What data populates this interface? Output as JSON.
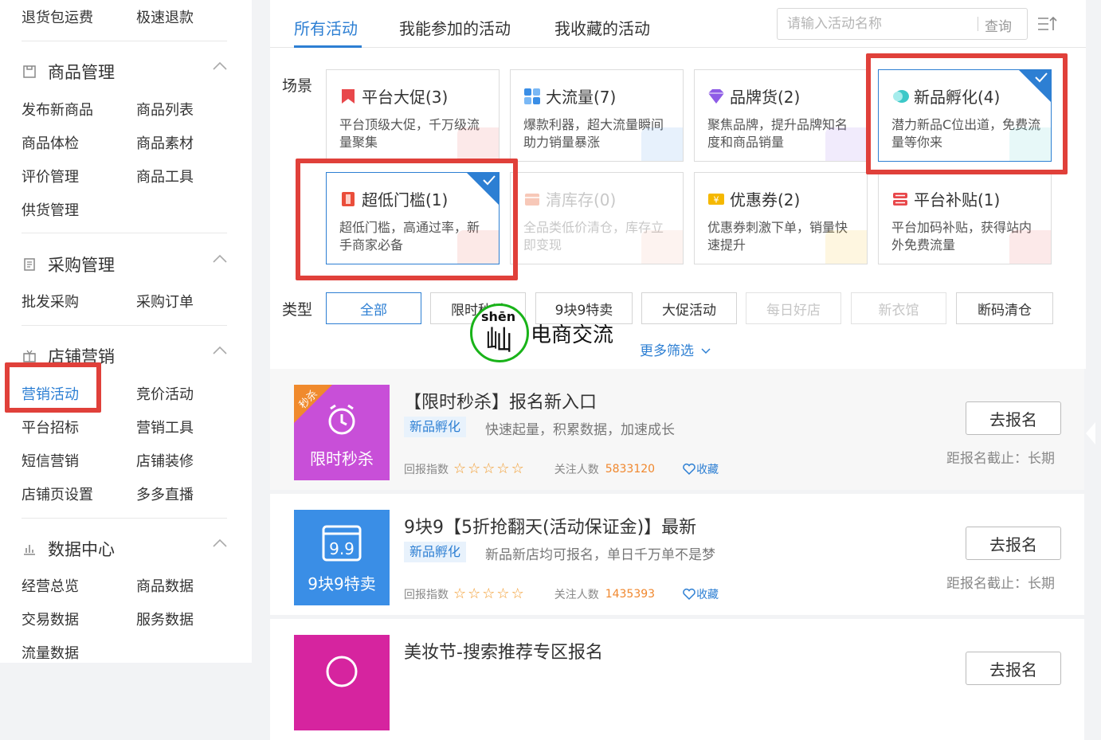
{
  "sidebar": {
    "top_row": [
      "退货包运费",
      "极速退款"
    ],
    "sections": [
      {
        "title": "商品管理",
        "icon": "clipboard-icon",
        "items": [
          "发布新商品",
          "商品列表",
          "商品体检",
          "商品素材",
          "评价管理",
          "商品工具",
          "供货管理"
        ]
      },
      {
        "title": "采购管理",
        "icon": "purchase-list-icon",
        "items": [
          "批发采购",
          "采购订单"
        ]
      },
      {
        "title": "店铺营销",
        "icon": "gift-icon",
        "items": [
          "营销活动",
          "竞价活动",
          "平台招标",
          "营销工具",
          "短信营销",
          "店铺装修",
          "店铺页设置",
          "多多直播"
        ]
      },
      {
        "title": "数据中心",
        "icon": "bar-chart-icon",
        "items": [
          "经营总览",
          "商品数据",
          "交易数据",
          "服务数据",
          "流量数据"
        ]
      }
    ],
    "active_item": "营销活动"
  },
  "header": {
    "tabs": [
      {
        "label": "所有活动",
        "active": true
      },
      {
        "label": "我能参加的活动",
        "active": false
      },
      {
        "label": "我收藏的活动",
        "active": false
      }
    ],
    "search_placeholder": "请输入活动名称",
    "search_button": "查询"
  },
  "scene": {
    "label": "场景",
    "cards": [
      {
        "title": "平台大促(3)",
        "desc": "平台顶级大促，千万级流量聚集",
        "icon": "flag-icon",
        "color": "#e8484b",
        "selected": false,
        "disabled": false
      },
      {
        "title": "大流量(7)",
        "desc": "爆款利器，超大流量瞬间助力销量暴涨",
        "icon": "grid-icon",
        "color": "#3a8ee6",
        "selected": false,
        "disabled": false
      },
      {
        "title": "品牌货(2)",
        "desc": "聚焦品牌，提升品牌知名度和商品销量",
        "icon": "diamond-icon",
        "color": "#8e5ce6",
        "selected": false,
        "disabled": false
      },
      {
        "title": "新品孵化(4)",
        "desc": "潜力新品C位出道，免费流量等你来",
        "icon": "egg-icon",
        "color": "#3cc8c8",
        "selected": true,
        "disabled": false
      },
      {
        "title": "超低门槛(1)",
        "desc": "超低门槛，高通过率，新手商家必备",
        "icon": "door-icon",
        "color": "#ea4e3b",
        "selected": true,
        "disabled": false
      },
      {
        "title": "清库存(0)",
        "desc": "全品类低价清仓，库存立即变现",
        "icon": "box-icon",
        "color": "#f0a080",
        "selected": false,
        "disabled": true
      },
      {
        "title": "优惠券(2)",
        "desc": "优惠券刺激下单，销量快速提升",
        "icon": "coupon-icon",
        "color": "#f5b800",
        "selected": false,
        "disabled": false
      },
      {
        "title": "平台补贴(1)",
        "desc": "平台加码补贴，获得站内外免费流量",
        "icon": "subsidy-icon",
        "color": "#e8484b",
        "selected": false,
        "disabled": false
      }
    ]
  },
  "type_filter": {
    "label": "类型",
    "chips": [
      {
        "label": "全部",
        "state": "active"
      },
      {
        "label": "限时秒杀",
        "state": "normal"
      },
      {
        "label": "9块9特卖",
        "state": "normal"
      },
      {
        "label": "大促活动",
        "state": "normal"
      },
      {
        "label": "每日好店",
        "state": "disabled"
      },
      {
        "label": "新衣馆",
        "state": "disabled"
      },
      {
        "label": "断码清仓",
        "state": "normal"
      }
    ],
    "more_label": "更多筛选"
  },
  "watermark": {
    "top": "shēn",
    "glyph": "屾",
    "text": "电商交流"
  },
  "activities": [
    {
      "thumb_label": "限时秒杀",
      "thumb_badge": "秒杀",
      "thumb_color": "#c84fd8",
      "title": "【限时秒杀】报名新入口",
      "tag": "新品孵化",
      "subtitle": "快速起量，积累数据，加速成长",
      "rating_label": "回报指数",
      "rating": 5,
      "fans_label": "关注人数",
      "fans": "5833120",
      "fav_label": "收藏",
      "button": "去报名",
      "deadline": "距报名截止：长期"
    },
    {
      "thumb_label": "9块9特卖",
      "thumb_badge": "",
      "thumb_color": "#3a8ee6",
      "title": "9块9【5折抢翻天(活动保证金)】最新",
      "tag": "新品孵化",
      "subtitle": "新品新店均可报名，单日千万单不是梦",
      "rating_label": "回报指数",
      "rating": 5,
      "fans_label": "关注人数",
      "fans": "1435393",
      "fav_label": "收藏",
      "button": "去报名",
      "deadline": "距报名截止：长期"
    },
    {
      "thumb_label": "",
      "thumb_badge": "",
      "thumb_color": "#d6249f",
      "title": "美妆节-搜索推荐专区报名",
      "tag": "",
      "subtitle": "",
      "rating_label": "",
      "fans_label": "",
      "fans": "",
      "fav_label": "",
      "button": "去报名",
      "deadline": ""
    }
  ]
}
